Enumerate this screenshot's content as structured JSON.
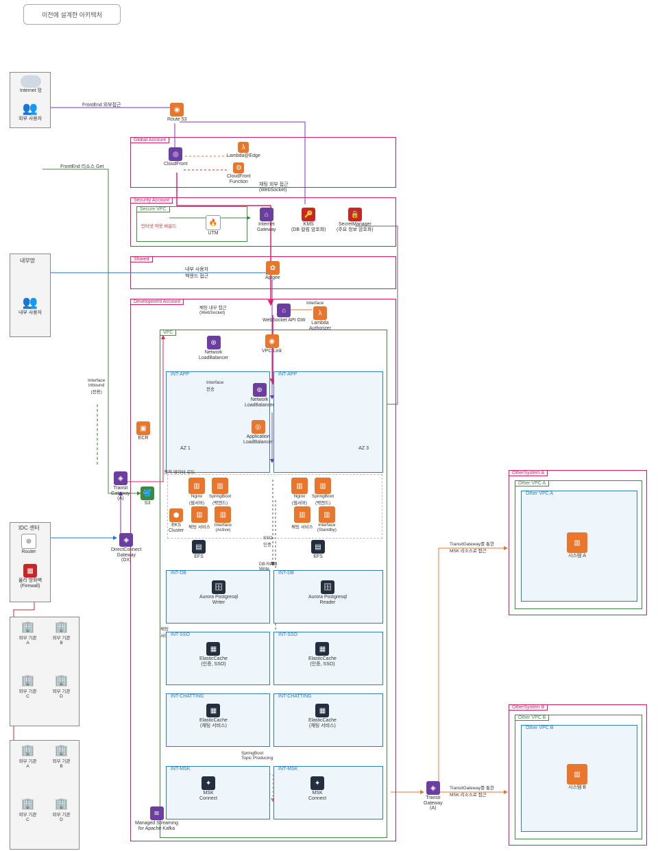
{
  "title": "이전에 설계한 아키텍처",
  "left": {
    "internet": "Internet 망",
    "ext_users": "외부 사용자",
    "internal_net": "내부망",
    "int_users": "내부 사용자",
    "idc": "IDC 센터",
    "router": "Router",
    "firewall": "물리 방화벽\n(Firewall)",
    "orgA": "외부 기관\nA",
    "orgB": "외부 기관\nB",
    "orgC": "외부 기관\nC",
    "orgD": "외부 기관\nD"
  },
  "flows": {
    "fe_ext": "FrontEnd 외부접근",
    "fe_get": "FrontEnd 리소스 Get",
    "chat_ext": "채팅 외부 접근\n(WebSocket)",
    "chat_int": "채팅 내부 접근\n(WebSocket)",
    "int_backend": "내부 사용자\n백엔드 접근",
    "iface_inbound": "Interface\nInbound\n(전용)",
    "iface_forward": "Interface\n전송",
    "interface": "Interface",
    "inet_out": "인터넷 아웃 바운드",
    "static_load": "정적 데이터 로드",
    "sso_auth": "SSO\n인증",
    "db_rw": "DB Read\nWrite",
    "chatting": "채팅\n서버",
    "sb_topic": "SpringBoot\nTopic Producing",
    "tgw_msk": "TransitGateway를 통한\nMSK 리소스로 접근"
  },
  "route53": "Route 53",
  "global": {
    "tag": "Global Account",
    "cloudfront": "CloudFront",
    "lambda_edge": "Lambda@Edge",
    "cf_func": "CloudFront\nFunction"
  },
  "security": {
    "tag": "Security Account",
    "svpc": "Secure VPC",
    "utm": "UTM",
    "igw": "Internet\nGateway",
    "kms": "KMS\n(DB 컬럼 암호화)",
    "sm": "SecretManager\n(주요 정보 암호화)"
  },
  "shared": {
    "tag": "Shared",
    "apigee": "Apigee"
  },
  "dev": {
    "tag": "Development Account",
    "ws_api": "WebSocket API GW",
    "lambda_auth": "Lambda\nAuthorizer",
    "vpc": "VPC",
    "nlb1": "Network\nLoadBalancer",
    "nlb2": "Network\nLoadBalancer",
    "alb": "Application\nLoadBalancer",
    "vpc_link": "VPC Link",
    "ecr": "ECR",
    "az1": "AZ 1",
    "az3": "AZ 3",
    "intApp": "INT-APP",
    "nginx": "Nginx\n(웹서버)",
    "springboot": "SpringBoot\n(백엔드)",
    "chat_svc": "채팅 서비스",
    "iface_active": "Interface\n(Active)",
    "iface_standby": "Interface\n(Standby)",
    "eks": "EKS\nCluster",
    "efs": "EFS",
    "intDb": "INT-DB",
    "aurora_w": "Aurora Postgresql\nWriter",
    "aurora_r": "Aurora Postgresql\nReader",
    "intSso": "INT-SSO",
    "ec_sso": "ElasticCache\n(인증, SSO)",
    "intChat": "INT-CHATTING",
    "ec_chat": "ElasticCache\n(채팅 서비스)",
    "intMsk": "INT-MSK",
    "msk_connect": "MSK\nConnect",
    "msk": "Managed Streaming\nfor Apache Kafka"
  },
  "conn": {
    "s3": "S3",
    "tgwA": "Transit\nGateway\n(A)",
    "dx": "DirectConnect\nGateway\n(DX)"
  },
  "otherA": {
    "tag": "OtherSystem A",
    "ovpcA": "Other VPC A",
    "sysA": "시스템 A"
  },
  "otherB": {
    "tag": "OtherSystem B",
    "ovpcB": "Other VPC B",
    "sysB": "시스템 B"
  },
  "tgwA2": "Transit\nGateway\n(A)"
}
